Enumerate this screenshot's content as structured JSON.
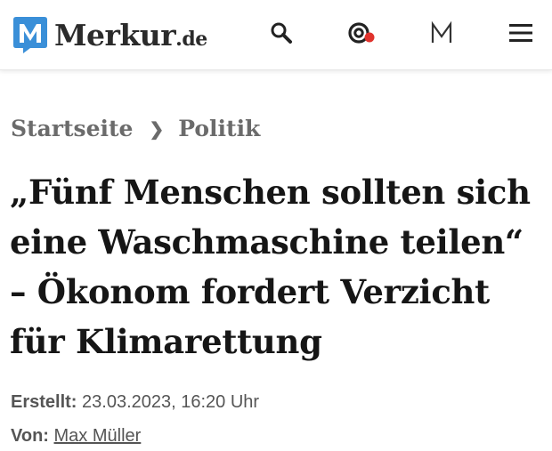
{
  "header": {
    "logo_text": "Merkur",
    "logo_tld": ".de",
    "icons": [
      "search-icon",
      "recommendations-icon",
      "m-account-icon",
      "menu-icon"
    ],
    "colors": {
      "logo_blue": "#3a8fd8",
      "notification_dot": "#e0322c"
    }
  },
  "breadcrumb": {
    "home": "Startseite",
    "separator": "❯",
    "section": "Politik"
  },
  "article": {
    "headline": "„Fünf Menschen sollten sich eine Waschmaschine teilen“ – Ökonom fordert Verzicht für Klimarettung",
    "created_label": "Erstellt:",
    "created_value": "23.03.2023, 16:20 Uhr",
    "author_label": "Von:",
    "author_name": "Max Müller"
  }
}
